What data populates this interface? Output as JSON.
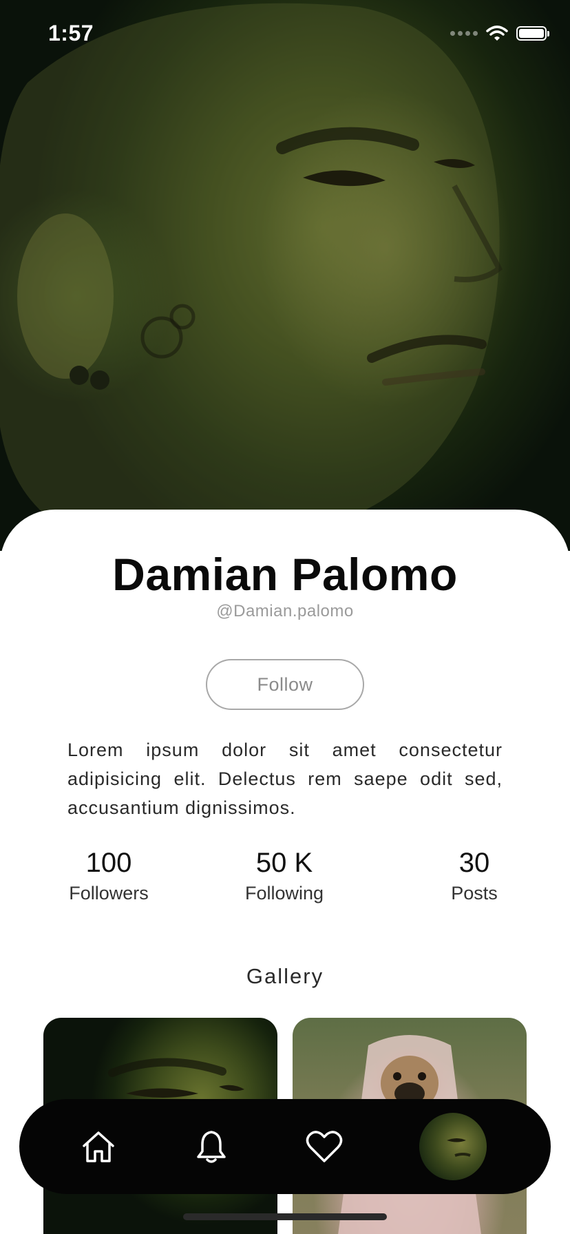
{
  "status_bar": {
    "time": "1:57",
    "battery_level": 1.0,
    "signal_icon": "cellular-signal-icon",
    "wifi_icon": "wifi-icon"
  },
  "hero": {
    "image_description_icon": "profile-cover-photo"
  },
  "profile": {
    "name": "Damian Palomo",
    "handle": "@Damian.palomo",
    "follow_label": "Follow",
    "bio": "Lorem ipsum dolor sit amet consectetur adipisicing elit. Delectus rem saepe odit sed, accusantium dignissimos."
  },
  "stats": [
    {
      "value": "100",
      "label": "Followers"
    },
    {
      "value": "50 K",
      "label": "Following"
    },
    {
      "value": "30",
      "label": "Posts"
    }
  ],
  "gallery": {
    "title": "Gallery",
    "items": [
      "gallery-photo-portrait",
      "gallery-photo-pug"
    ]
  },
  "tabbar": {
    "items": [
      {
        "icon": "home-icon"
      },
      {
        "icon": "bell-icon"
      },
      {
        "icon": "heart-icon"
      },
      {
        "icon": "profile-avatar"
      }
    ]
  },
  "colors": {
    "accent": "#000000",
    "background": "#ffffff",
    "muted_text": "#9a9a9a"
  }
}
